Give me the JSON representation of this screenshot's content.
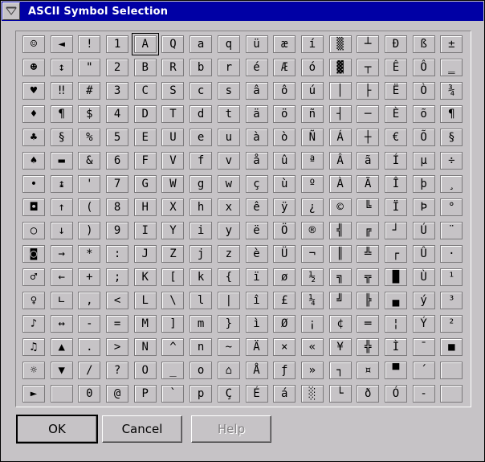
{
  "window": {
    "title": "ASCII Symbol Selection"
  },
  "buttons": {
    "ok": "OK",
    "cancel": "Cancel",
    "help": "Help"
  },
  "selected_symbol": "A",
  "grid_columns": [
    [
      "☺",
      "☻",
      "♥",
      "♦",
      "♣",
      "♠",
      "•",
      "◘",
      "○",
      "◙",
      "♂",
      "♀",
      "♪",
      "♫",
      "☼",
      "►"
    ],
    [
      "◄",
      "↕",
      "‼",
      "¶",
      "§",
      "▬",
      "↨",
      "↑",
      "↓",
      "→",
      "←",
      "∟",
      "↔",
      "▲",
      "▼",
      ""
    ],
    [
      "!",
      "\"",
      "#",
      "$",
      "%",
      "&",
      "'",
      "(",
      ")",
      "*",
      "+",
      ",",
      "-",
      ".",
      "/",
      "0"
    ],
    [
      "1",
      "2",
      "3",
      "4",
      "5",
      "6",
      "7",
      "8",
      "9",
      ":",
      ";",
      "<",
      "=",
      ">",
      "?",
      "@"
    ],
    [
      "A",
      "B",
      "C",
      "D",
      "E",
      "F",
      "G",
      "H",
      "I",
      "J",
      "K",
      "L",
      "M",
      "N",
      "O",
      "P"
    ],
    [
      "Q",
      "R",
      "S",
      "T",
      "U",
      "V",
      "W",
      "X",
      "Y",
      "Z",
      "[",
      "\\",
      "]",
      "^",
      "_",
      "`"
    ],
    [
      "a",
      "b",
      "c",
      "d",
      "e",
      "f",
      "g",
      "h",
      "i",
      "j",
      "k",
      "l",
      "m",
      "n",
      "o",
      "p"
    ],
    [
      "q",
      "r",
      "s",
      "t",
      "u",
      "v",
      "w",
      "x",
      "y",
      "z",
      "{",
      "|",
      "}",
      "~",
      "⌂",
      "Ç"
    ],
    [
      "ü",
      "é",
      "â",
      "ä",
      "à",
      "å",
      "ç",
      "ê",
      "ë",
      "è",
      "ï",
      "î",
      "ì",
      "Ä",
      "Å",
      "É"
    ],
    [
      "æ",
      "Æ",
      "ô",
      "ö",
      "ò",
      "û",
      "ù",
      "ÿ",
      "Ö",
      "Ü",
      "ø",
      "£",
      "Ø",
      "×",
      "ƒ",
      "á"
    ],
    [
      "í",
      "ó",
      "ú",
      "ñ",
      "Ñ",
      "ª",
      "º",
      "¿",
      "®",
      "¬",
      "½",
      "¼",
      "¡",
      "«",
      "»",
      "░"
    ],
    [
      "▒",
      "▓",
      "│",
      "┤",
      "Á",
      "Â",
      "À",
      "©",
      "╣",
      "║",
      "╗",
      "╝",
      "¢",
      "¥",
      "┐",
      "└"
    ],
    [
      "┴",
      "┬",
      "├",
      "─",
      "┼",
      "ã",
      "Ã",
      "╚",
      "╔",
      "╩",
      "╦",
      "╠",
      "═",
      "╬",
      "¤",
      "ð"
    ],
    [
      "Ð",
      "Ê",
      "Ë",
      "È",
      "€",
      "Í",
      "Î",
      "Ï",
      "┘",
      "┌",
      "█",
      "▄",
      "¦",
      "Ì",
      "▀",
      "Ó"
    ],
    [
      "ß",
      "Ô",
      "Ò",
      "õ",
      "Õ",
      "µ",
      "þ",
      "Þ",
      "Ú",
      "Û",
      "Ù",
      "ý",
      "Ý",
      "¯",
      "´",
      "-"
    ],
    [
      "±",
      "‗",
      "¾",
      "¶",
      "§",
      "÷",
      "¸",
      "°",
      "¨",
      "·",
      "¹",
      "³",
      "²",
      "■",
      "",
      ""
    ]
  ]
}
